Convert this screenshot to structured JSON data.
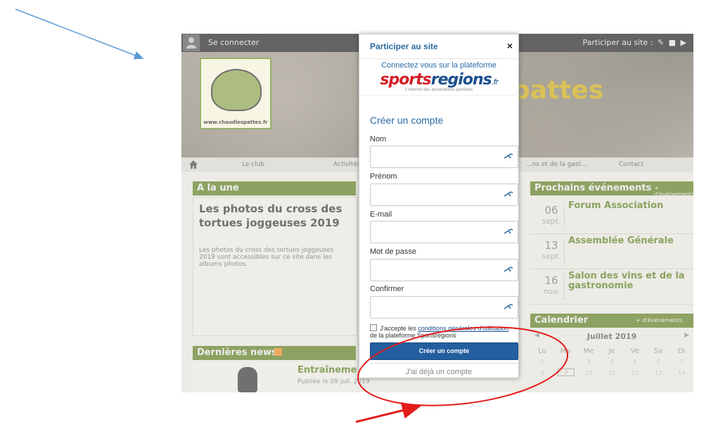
{
  "topbar": {
    "connect_label": "Se connecter",
    "participate_label": "Participer au site :"
  },
  "banner": {
    "logo_url_text": "www.chaudlespattes.fr",
    "title_fragment": "pattes"
  },
  "nav": {
    "items": [
      "Le club",
      "Activités",
      "...ns et de la gast...",
      "Contact"
    ]
  },
  "aune": {
    "header": "A la une",
    "title": "Les photos du cross des tortues joggeuses 2019",
    "text": "Les photos du cross des tortues joggeuses 2019 sont accessibles sur ce site dans les albums photos."
  },
  "events": {
    "header": "Prochains événements",
    "header_link": "+ d'événements",
    "items": [
      {
        "day": "06",
        "month": "sept.",
        "name": "Forum Association"
      },
      {
        "day": "13",
        "month": "sept.",
        "name": "Assemblée Générale"
      },
      {
        "day": "16",
        "month": "nov.",
        "name": "Salon des vins et de la gastronomie"
      }
    ]
  },
  "calendar": {
    "header": "Calendrier",
    "header_link": "+ d'événements",
    "month": "Juillet 2019",
    "weekdays": [
      "Lu",
      "Ma",
      "Me",
      "Je",
      "Ve",
      "Sa",
      "Di"
    ],
    "row1": [
      "1",
      "2",
      "3",
      "4",
      "5",
      "6",
      "7"
    ],
    "row2": [
      "8",
      "9",
      "10",
      "11",
      "12",
      "13",
      "14"
    ]
  },
  "news": {
    "header": "Dernières news",
    "title": "Entraîneme",
    "date": "Publiée le 09 juil. 2019"
  },
  "modal": {
    "title": "Participer au site",
    "close_symbol": "×",
    "connect_text": "Connectez vous sur la plateforme",
    "brand_part1": "sports",
    "brand_part2": "regions",
    "brand_tld": ".fr",
    "tagline": "L'internet des associations sportives",
    "subtitle": "Créer un compte",
    "fields": [
      {
        "label": "Nom",
        "value": ""
      },
      {
        "label": "Prénom",
        "value": ""
      },
      {
        "label": "E-mail",
        "value": ""
      },
      {
        "label": "Mot de passe",
        "value": ""
      },
      {
        "label": "Confirmer",
        "value": ""
      }
    ],
    "terms_prefix": "J'accepte les",
    "terms_link": "conditions générales d'utilisation",
    "terms_suffix": "de la plateforme Sportsregions",
    "create_button": "Créer un compte",
    "login_link": "J'ai déjà un compte"
  },
  "colors": {
    "modal_accent": "#2a6aa3",
    "button": "#235f9f",
    "panel_green": "#5c7a1f",
    "annotation_blue": "#5b9bd5",
    "annotation_red": "#e31b1b"
  }
}
